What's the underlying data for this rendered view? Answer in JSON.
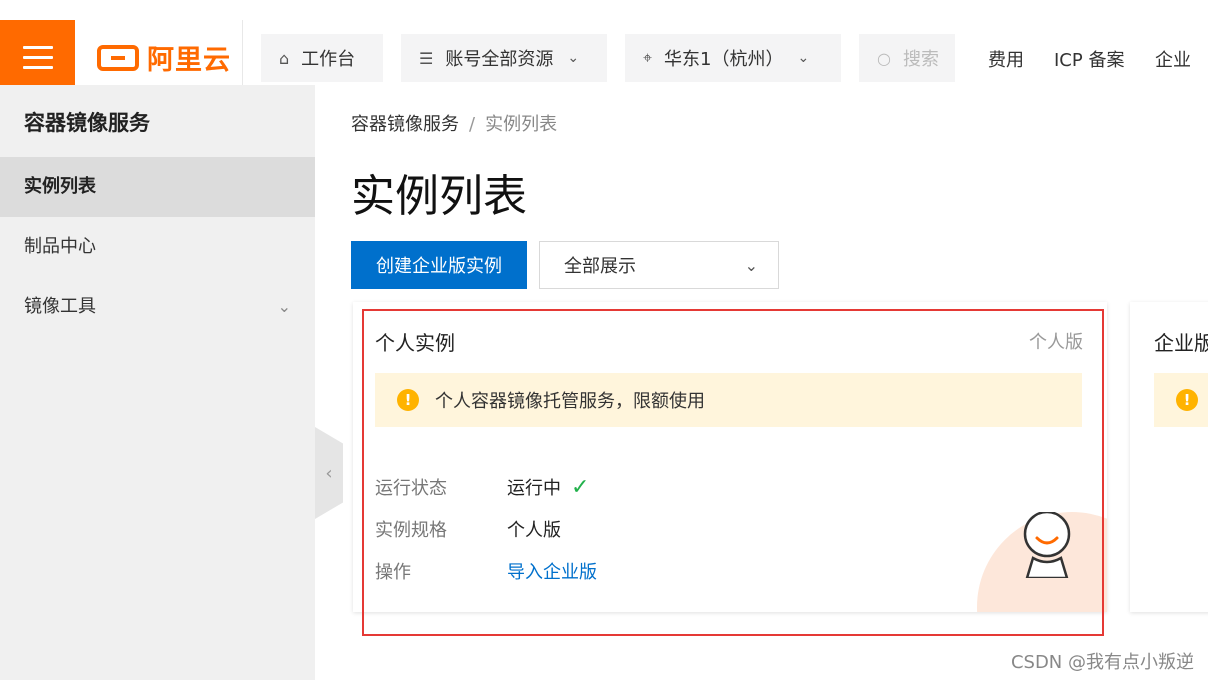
{
  "topbar": {
    "logo_text": "阿里云",
    "workbench_label": "工作台",
    "resources_label": "账号全部资源",
    "region_label": "华东1（杭州）",
    "search_placeholder": "搜索",
    "links": [
      "费用",
      "ICP 备案",
      "企业"
    ]
  },
  "sidebar": {
    "title": "容器镜像服务",
    "items": [
      {
        "label": "实例列表"
      },
      {
        "label": "制品中心"
      },
      {
        "label": "镜像工具"
      }
    ]
  },
  "breadcrumb": {
    "root": "容器镜像服务",
    "separator": "/",
    "current": "实例列表"
  },
  "page": {
    "title": "实例列表",
    "create_button": "创建企业版实例",
    "filter_value": "全部展示"
  },
  "personal_card": {
    "title": "个人实例",
    "badge": "个人版",
    "notice": "个人容器镜像托管服务，限额使用",
    "rows": [
      {
        "label": "运行状态",
        "value": "运行中"
      },
      {
        "label": "实例规格",
        "value": "个人版"
      },
      {
        "label": "操作",
        "value": "导入企业版"
      }
    ]
  },
  "enterprise_card": {
    "title": "企业版"
  },
  "watermark": "CSDN @我有点小叛逆",
  "colors": {
    "brand": "#ff6a00",
    "primary": "#0070cc",
    "notice_bg": "#fff5dc",
    "warn": "#ffb300",
    "success": "#22b14c",
    "highlight_border": "#e53935"
  }
}
